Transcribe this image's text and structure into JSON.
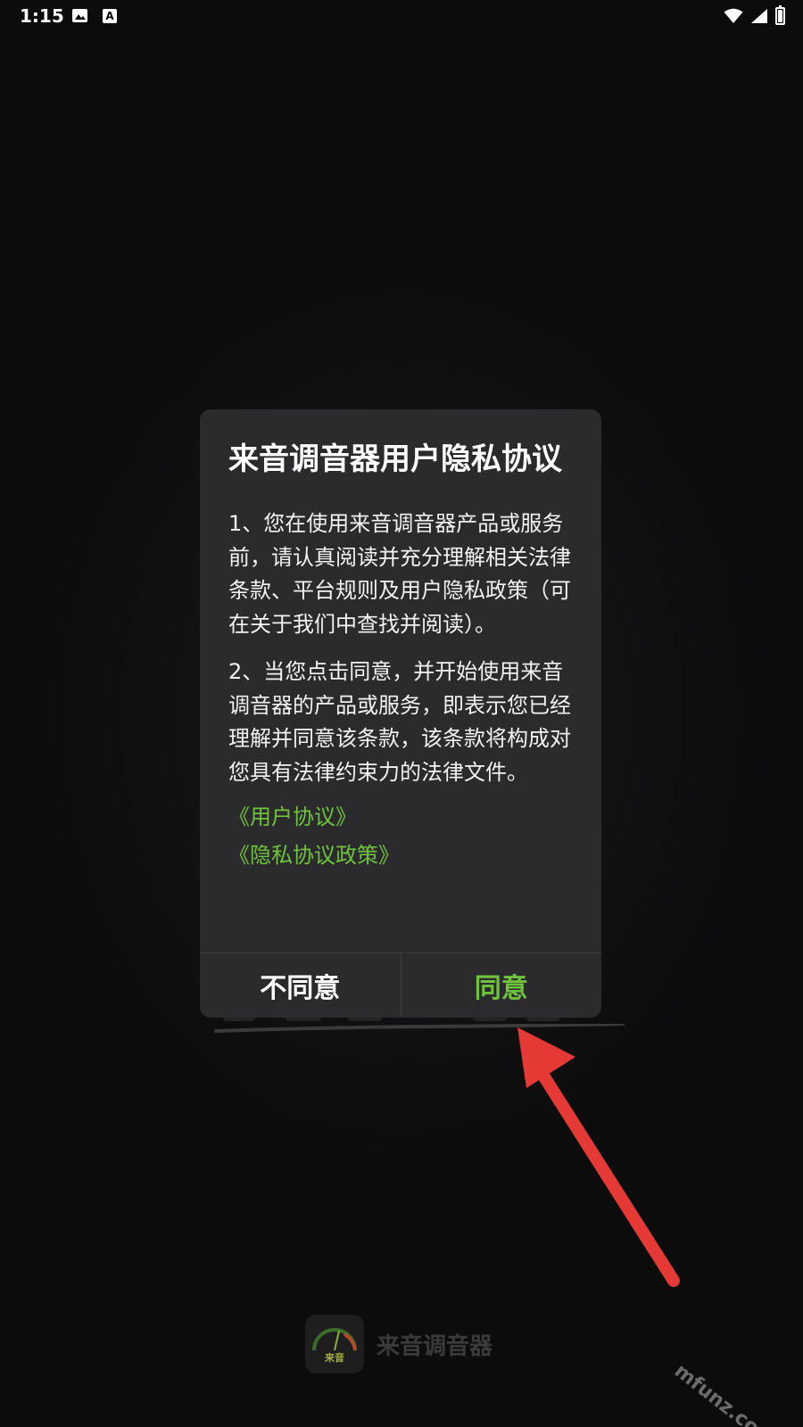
{
  "status_bar": {
    "time": "1:15",
    "notification_icons": [
      "image-icon",
      "font-a-icon"
    ],
    "system_icons": [
      "wifi-icon",
      "signal-icon",
      "battery-charging-icon"
    ],
    "a_glyph": "A"
  },
  "dialog": {
    "title": "来音调音器用户隐私协议",
    "paragraphs": [
      "1、您在使用来音调音器产品或服务前，请认真阅读并充分理解相关法律条款、平台规则及用户隐私政策（可在关于我们中查找并阅读）。",
      "2、当您点击同意，并开始使用来音调音器的产品或服务，即表示您已经理解并同意该条款，该条款将构成对您具有法律约束力的法律文件。"
    ],
    "links": [
      "《用户协议》",
      "《隐私协议政策》"
    ],
    "buttons": {
      "disagree": "不同意",
      "agree": "同意"
    }
  },
  "splash": {
    "brand_name": "来音调音器",
    "logo_text": "来音"
  },
  "watermark": "mfunz.com 魔趣网",
  "colors": {
    "background": "#0c0c0d",
    "dialog": "#2b2b2d",
    "accent_green": "#6fc33c",
    "arrow_red": "#e53935"
  }
}
